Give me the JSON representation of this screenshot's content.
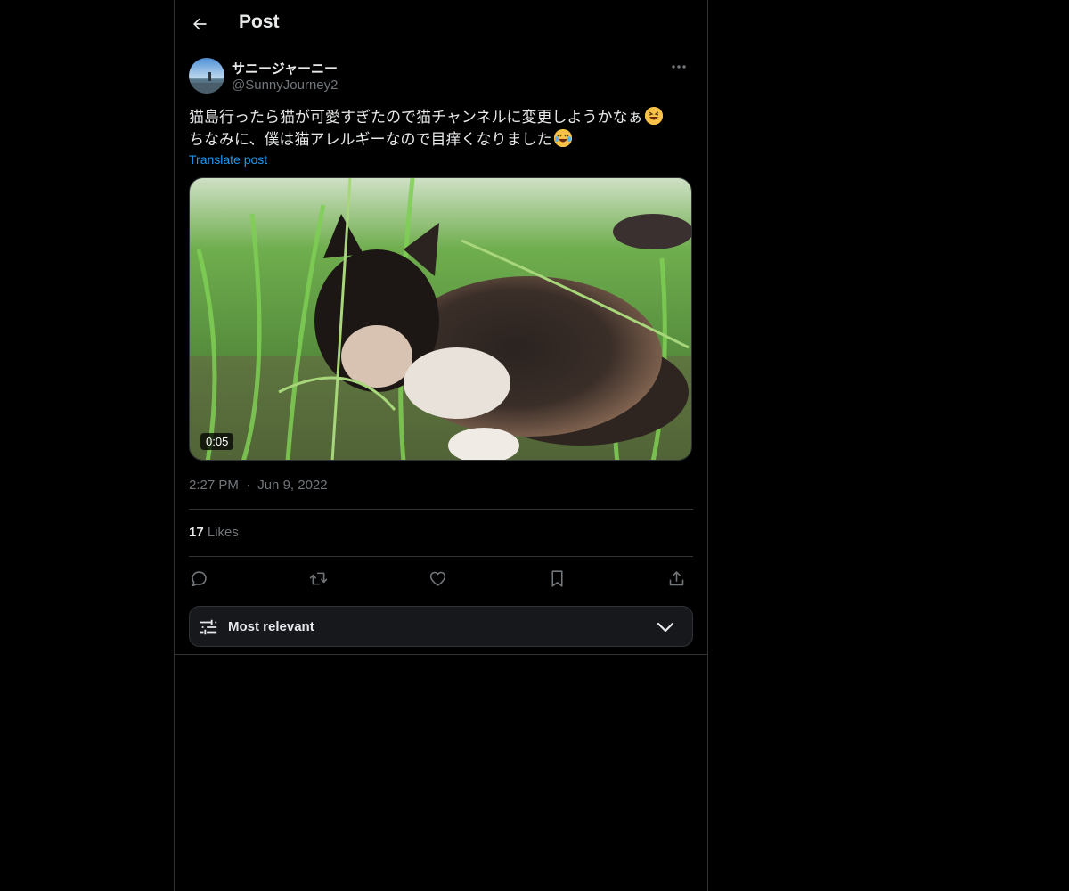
{
  "header": {
    "title": "Post",
    "back_icon": "arrow-left-icon"
  },
  "author": {
    "display_name": "サニージャーニー",
    "handle": "@SunnyJourney2"
  },
  "post": {
    "text_lines": [
      "猫島行ったら猫が可愛すぎたので猫チャンネルに変更しようかなぁ",
      "ちなみに、僕は猫アレルギーなので目痒くなりました"
    ],
    "emojis": [
      "grinning-squinting-face-emoji",
      "face-with-tears-of-joy-emoji"
    ],
    "translate_label": "Translate post",
    "media": {
      "type": "video",
      "duration": "0:05"
    },
    "time": "2:27 PM",
    "separator": "·",
    "date": "Jun 9, 2022",
    "likes_count": "17",
    "likes_label": "Likes"
  },
  "actions": [
    "reply-icon",
    "repost-icon",
    "like-icon",
    "bookmark-icon",
    "share-icon"
  ],
  "sort": {
    "label": "Most relevant"
  },
  "colors": {
    "background": "#000000",
    "text": "#e7e9ea",
    "secondary_text": "#71767b",
    "link": "#1d9bf0",
    "border": "#2f3336",
    "sort_button_bg": "#16181c"
  }
}
